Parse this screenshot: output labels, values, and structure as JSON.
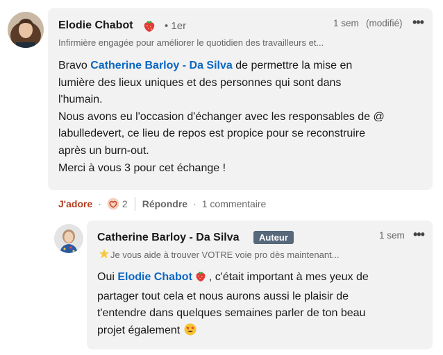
{
  "comment1": {
    "author": "Elodie Chabot",
    "degree": "• 1er",
    "headline": "Infirmière engagée pour améliorer le quotidien des travailleurs et...",
    "time": "1 sem",
    "edited": "(modifié)",
    "more": "•••",
    "body": {
      "p1_pre": "Bravo ",
      "p1_mention": "Catherine Barloy - Da Silva",
      "p1_post": " de permettre la mise en",
      "line2": "lumière des lieux uniques et des personnes qui sont dans",
      "line3": "l'humain.",
      "line4": "Nous avons eu l'occasion d'échanger avec les responsables de @",
      "line5": "labulledevert, ce lieu de repos est propice pour se reconstruire",
      "line6": "après un burn-out.",
      "line7": "Merci à vous 3 pour cet échange !"
    }
  },
  "actions": {
    "like": "J'adore",
    "dot": "·",
    "reaction_count": "2",
    "reply": "Répondre",
    "comments": "1 commentaire"
  },
  "comment2": {
    "author": "Catherine Barloy - Da Silva",
    "badge": "Auteur",
    "time": "1 sem",
    "more": "•••",
    "headline": "Je vous aide à trouver VOTRE voie pro dès maintenant...",
    "body": {
      "p1_pre": "Oui ",
      "p1_mention": "Elodie Chabot",
      "p1_post": ", c'était important à mes yeux de",
      "line2": "partager tout cela et nous aurons aussi le plaisir de",
      "line3": "t'entendre dans quelques semaines parler de ton beau",
      "line4": "projet également"
    }
  },
  "colors": {
    "bubble": "#f2f2f2",
    "mention": "#0a66c2",
    "like": "#b24020",
    "badge": "#56687a"
  }
}
